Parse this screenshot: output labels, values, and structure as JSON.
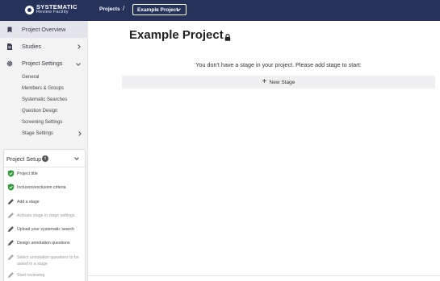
{
  "brand": {
    "line1": "SYSTEMATIC",
    "line2": "Review Facility"
  },
  "nav": {
    "projects_label": "Projects",
    "separator": "/",
    "project_select": "Example Project"
  },
  "sidebar": {
    "items": [
      {
        "label": "Project Overview",
        "icon": "bookmark-icon"
      },
      {
        "label": "Studies",
        "icon": "document-icon"
      },
      {
        "label": "Project Settings",
        "icon": "gear-icon"
      }
    ],
    "settings_children": [
      "General",
      "Members & Groups",
      "Systematic Searches",
      "Question Design",
      "Screening Settings",
      "Stage Settings"
    ]
  },
  "setup": {
    "title": "Project Setup",
    "info_glyph": "i",
    "steps": [
      {
        "label": "Project title",
        "status": "done",
        "icon": "shield-check-icon"
      },
      {
        "label": "Inclusion/exclusion criteria",
        "status": "done",
        "icon": "shield-check-icon"
      },
      {
        "label": "Add a stage",
        "status": "active",
        "icon": "pencil-icon"
      },
      {
        "label": "Activate stage in stage settings",
        "status": "pending",
        "icon": "pencil-icon"
      },
      {
        "label": "Upload your systematic search",
        "status": "active",
        "icon": "pencil-icon"
      },
      {
        "label": "Design annotation questions",
        "status": "active",
        "icon": "pencil-icon"
      },
      {
        "label": "Select annotation questions to be asked in a stage",
        "status": "pending",
        "icon": "pencil-icon"
      },
      {
        "label": "Start reviewing",
        "status": "pending",
        "icon": "pencil-icon"
      }
    ]
  },
  "main": {
    "title": "Example Project",
    "empty_message": "You don't have a stage in your project. Please add stage to start:",
    "new_stage_label": "New Stage"
  },
  "colors": {
    "topbar": "#26325a",
    "done_green": "#2e9a3b",
    "sidebar_bg": "#f3f3f4"
  }
}
